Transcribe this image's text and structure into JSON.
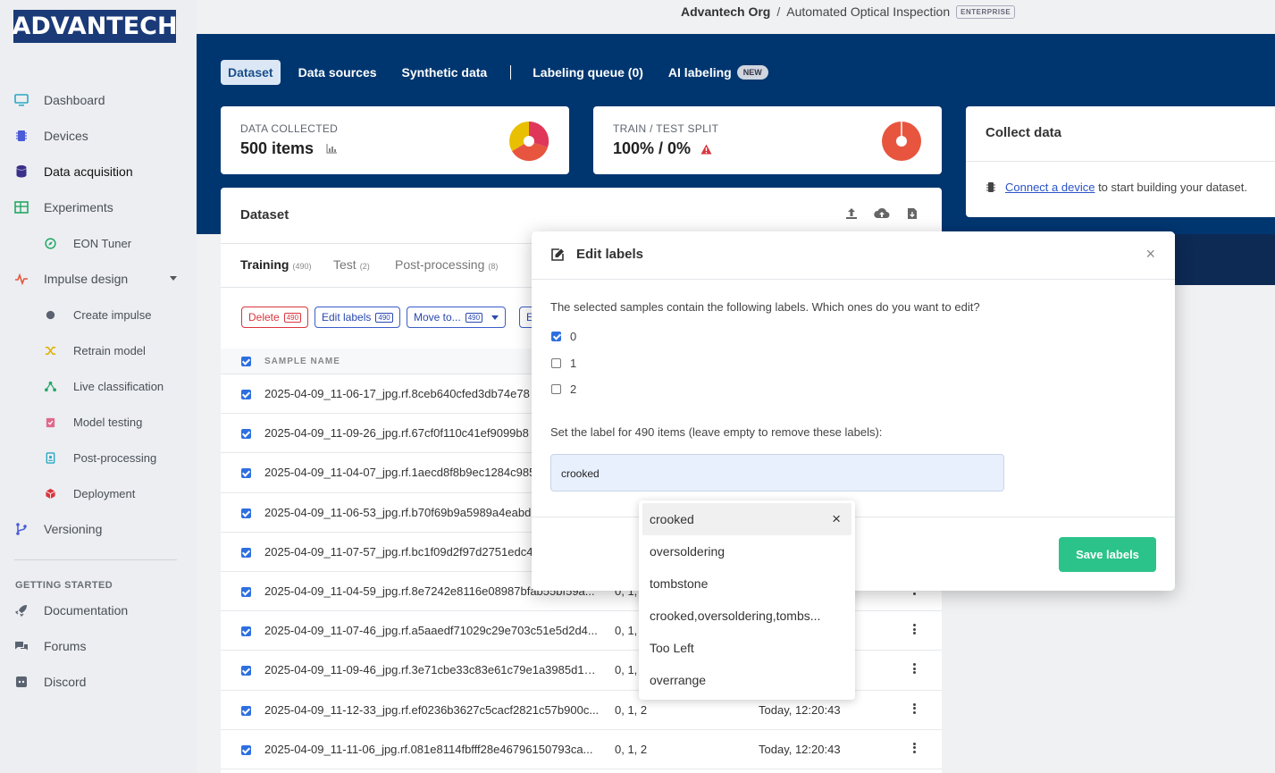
{
  "brand": {
    "logo_text": "ADVANTECH"
  },
  "breadcrumb": {
    "org": "Advantech Org",
    "separator": "/",
    "project": "Automated Optical Inspection",
    "badge": "ENTERPRISE"
  },
  "sidebar": {
    "items": [
      {
        "label": "Dashboard",
        "icon": "monitor-icon"
      },
      {
        "label": "Devices",
        "icon": "chip-icon"
      },
      {
        "label": "Data acquisition",
        "icon": "database-icon"
      },
      {
        "label": "Experiments",
        "icon": "table-icon"
      },
      {
        "label": "EON Tuner",
        "icon": "compass-icon"
      },
      {
        "label": "Impulse design",
        "icon": "pulse-icon"
      },
      {
        "label": "Create impulse",
        "icon": "dot-icon"
      },
      {
        "label": "Retrain model",
        "icon": "shuffle-icon"
      },
      {
        "label": "Live classification",
        "icon": "network-icon"
      },
      {
        "label": "Model testing",
        "icon": "clipboard-check-icon"
      },
      {
        "label": "Post-processing",
        "icon": "tablet-icon"
      },
      {
        "label": "Deployment",
        "icon": "cube-icon"
      },
      {
        "label": "Versioning",
        "icon": "branch-icon"
      }
    ],
    "getting_started_heading": "GETTING STARTED",
    "help_items": [
      {
        "label": "Documentation",
        "icon": "rocket-icon"
      },
      {
        "label": "Forums",
        "icon": "chat-icon"
      },
      {
        "label": "Discord",
        "icon": "discord-icon"
      }
    ]
  },
  "tabs": [
    {
      "label": "Dataset",
      "active": true
    },
    {
      "label": "Data sources"
    },
    {
      "label": "Synthetic data"
    },
    {
      "label": "Labeling queue (0)"
    },
    {
      "label": "AI labeling",
      "badge": "NEW"
    }
  ],
  "stats": {
    "collected_label": "DATA COLLECTED",
    "collected_value": "500 items",
    "split_label": "TRAIN / TEST SPLIT",
    "split_value": "100% / 0%"
  },
  "collect": {
    "title": "Collect data",
    "link": "Connect a device",
    "text": " to start building your dataset."
  },
  "dataset": {
    "title": "Dataset",
    "subtabs": [
      {
        "label": "Training",
        "count": "(490)"
      },
      {
        "label": "Test",
        "count": "(2)"
      },
      {
        "label": "Post-processing",
        "count": "(8)"
      }
    ],
    "actions": {
      "delete": "Delete",
      "delete_count": "490",
      "edit": "Edit labels",
      "edit_count": "490",
      "move": "Move to...",
      "move_count": "490",
      "more": "E"
    },
    "column_header": "SAMPLE NAME",
    "rows": [
      {
        "name": "2025-04-09_11-06-17_jpg.rf.8ceb640cfed3db74e78",
        "labels": "",
        "date": ""
      },
      {
        "name": "2025-04-09_11-09-26_jpg.rf.67cf0f110c41ef9099b8",
        "labels": "",
        "date": ""
      },
      {
        "name": "2025-04-09_11-04-07_jpg.rf.1aecd8f8b9ec1284c985",
        "labels": "",
        "date": ""
      },
      {
        "name": "2025-04-09_11-06-53_jpg.rf.b70f69b9a5989a4eabd",
        "labels": "",
        "date": ""
      },
      {
        "name": "2025-04-09_11-07-57_jpg.rf.bc1f09d2f97d2751edc4",
        "labels": "",
        "date": ""
      },
      {
        "name": "2025-04-09_11-04-59_jpg.rf.8e7242e8116e08987bfab55bf59a...",
        "labels": "0, 1, 2",
        "date": ""
      },
      {
        "name": "2025-04-09_11-07-46_jpg.rf.a5aaedf71029c29e703c51e5d2d4...",
        "labels": "0, 1, 2",
        "date": ""
      },
      {
        "name": "2025-04-09_11-09-46_jpg.rf.3e71cbe33c83e61c79e1a3985d1e...",
        "labels": "0, 1, 2",
        "date": ""
      },
      {
        "name": "2025-04-09_11-12-33_jpg.rf.ef0236b3627c5cacf2821c57b900c...",
        "labels": "0, 1, 2",
        "date": "Today, 12:20:43"
      },
      {
        "name": "2025-04-09_11-11-06_jpg.rf.081e8114fbfff28e46796150793ca...",
        "labels": "0, 1, 2",
        "date": "Today, 12:20:43"
      }
    ]
  },
  "modal": {
    "title": "Edit labels",
    "close": "×",
    "question": "The selected samples contain the following labels. Which ones do you want to edit?",
    "options": [
      {
        "label": "0",
        "checked": true
      },
      {
        "label": "1",
        "checked": false
      },
      {
        "label": "2",
        "checked": false
      }
    ],
    "set_label_text": "Set the label for 490 items (leave empty to remove these labels):",
    "input_value": "crooked",
    "save": "Save labels"
  },
  "dropdown": {
    "items": [
      "crooked",
      "oversoldering",
      "tombstone",
      "crooked,oversoldering,tombs...",
      "Too Left",
      "overrange"
    ],
    "clear": "×"
  },
  "colors": {
    "brand": "#1b3a78",
    "hero": "#003670",
    "primary": "#2d6fe0",
    "save": "#2bc38a",
    "danger": "#d9363e"
  }
}
